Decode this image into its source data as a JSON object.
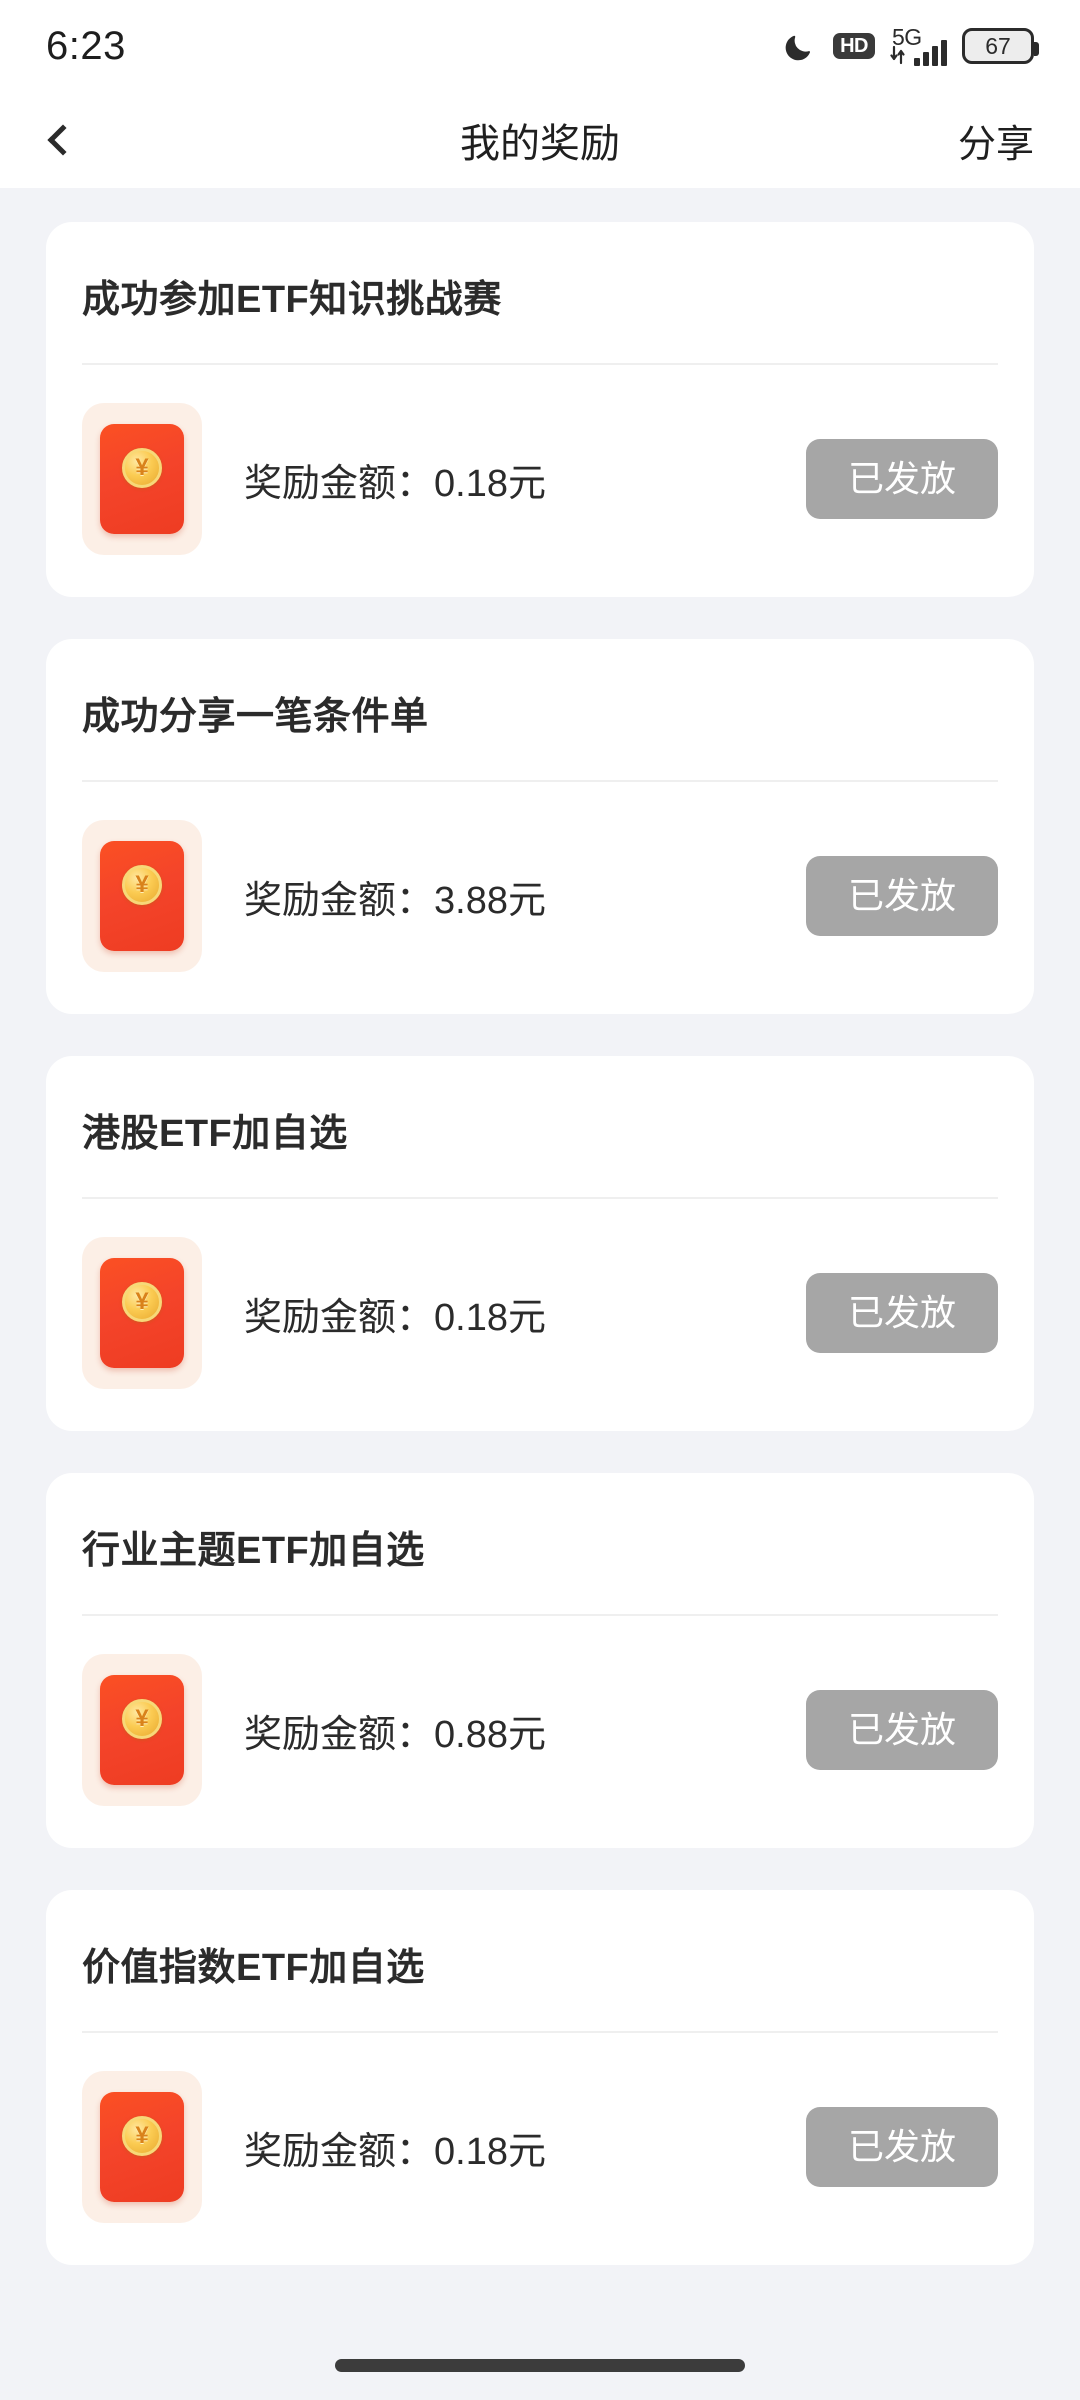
{
  "status_bar": {
    "time": "6:23",
    "dnd_icon": "moon-icon",
    "hd_label": "HD",
    "network_label": "5G",
    "signal_bars": 4,
    "battery_level": "67"
  },
  "header": {
    "back_icon": "chevron-left-icon",
    "title": "我的奖励",
    "share_label": "分享"
  },
  "colors": {
    "page_background": "#F2F3F7",
    "card_background": "#FFFFFF",
    "envelope_red": "#F4442A",
    "envelope_tile": "#FCEFE6",
    "coin_gold": "#FBCB52",
    "button_gray": "#A6A6A6",
    "text_primary": "#2B2B2B",
    "divider": "#EFEFEF"
  },
  "rewards": [
    {
      "title": "成功参加ETF知识挑战赛",
      "icon": "red-envelope-icon",
      "amount_label": "奖励金额：",
      "amount": "0.18元",
      "status": "已发放"
    },
    {
      "title": "成功分享一笔条件单",
      "icon": "red-envelope-icon",
      "amount_label": "奖励金额：",
      "amount": "3.88元",
      "status": "已发放"
    },
    {
      "title": "港股ETF加自选",
      "icon": "red-envelope-icon",
      "amount_label": "奖励金额：",
      "amount": "0.18元",
      "status": "已发放"
    },
    {
      "title": "行业主题ETF加自选",
      "icon": "red-envelope-icon",
      "amount_label": "奖励金额：",
      "amount": "0.88元",
      "status": "已发放"
    },
    {
      "title": "价值指数ETF加自选",
      "icon": "red-envelope-icon",
      "amount_label": "奖励金额：",
      "amount": "0.18元",
      "status": "已发放"
    }
  ],
  "coin_symbol": "¥",
  "home_indicator": "home-gesture-bar"
}
